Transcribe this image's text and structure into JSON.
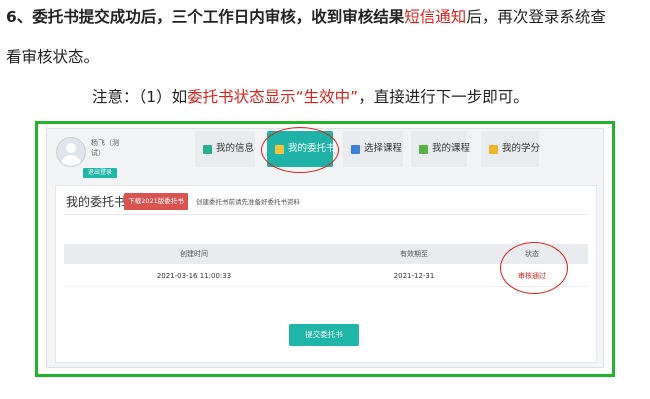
{
  "instructions": {
    "step_prefix": "6、委托书提交成功后，三个工作日内审核，收到审核结果",
    "step_highlight": "短信通知",
    "step_suffix": "后，再次登录系统查",
    "step_line2": "看审核状态。",
    "note_prefix": "注意：（1）如",
    "note_highlight": "委托书状态显示“生效中”",
    "note_suffix": "，直接进行下一步即可。"
  },
  "screenshot": {
    "user": {
      "name": "杨飞（测试）",
      "logout_label": "退出登录"
    },
    "tabs": [
      {
        "label": "我的信息",
        "icon": "id-card-icon",
        "active": false
      },
      {
        "label": "我的委托书",
        "icon": "document-icon",
        "active": true
      },
      {
        "label": "选择课程",
        "icon": "book-icon",
        "active": false
      },
      {
        "label": "我的课程",
        "icon": "course-icon",
        "active": false
      },
      {
        "label": "我的学分",
        "icon": "credit-icon",
        "active": false
      }
    ],
    "card": {
      "title": "我的委托书",
      "download_label": "下载2021版委托书",
      "hint": "创建委托书前请先准备好委托书资料"
    },
    "table": {
      "headers": [
        "创建时间",
        "有效期至",
        "状态"
      ],
      "rows": [
        [
          "2021-03-16 11:00:33",
          "2021-12-31",
          "审核通过"
        ]
      ]
    },
    "submit_label": "提交委托书",
    "colors": {
      "frame": "#22b32a",
      "accent": "#1fb3a7",
      "highlight": "#e0211b"
    }
  }
}
